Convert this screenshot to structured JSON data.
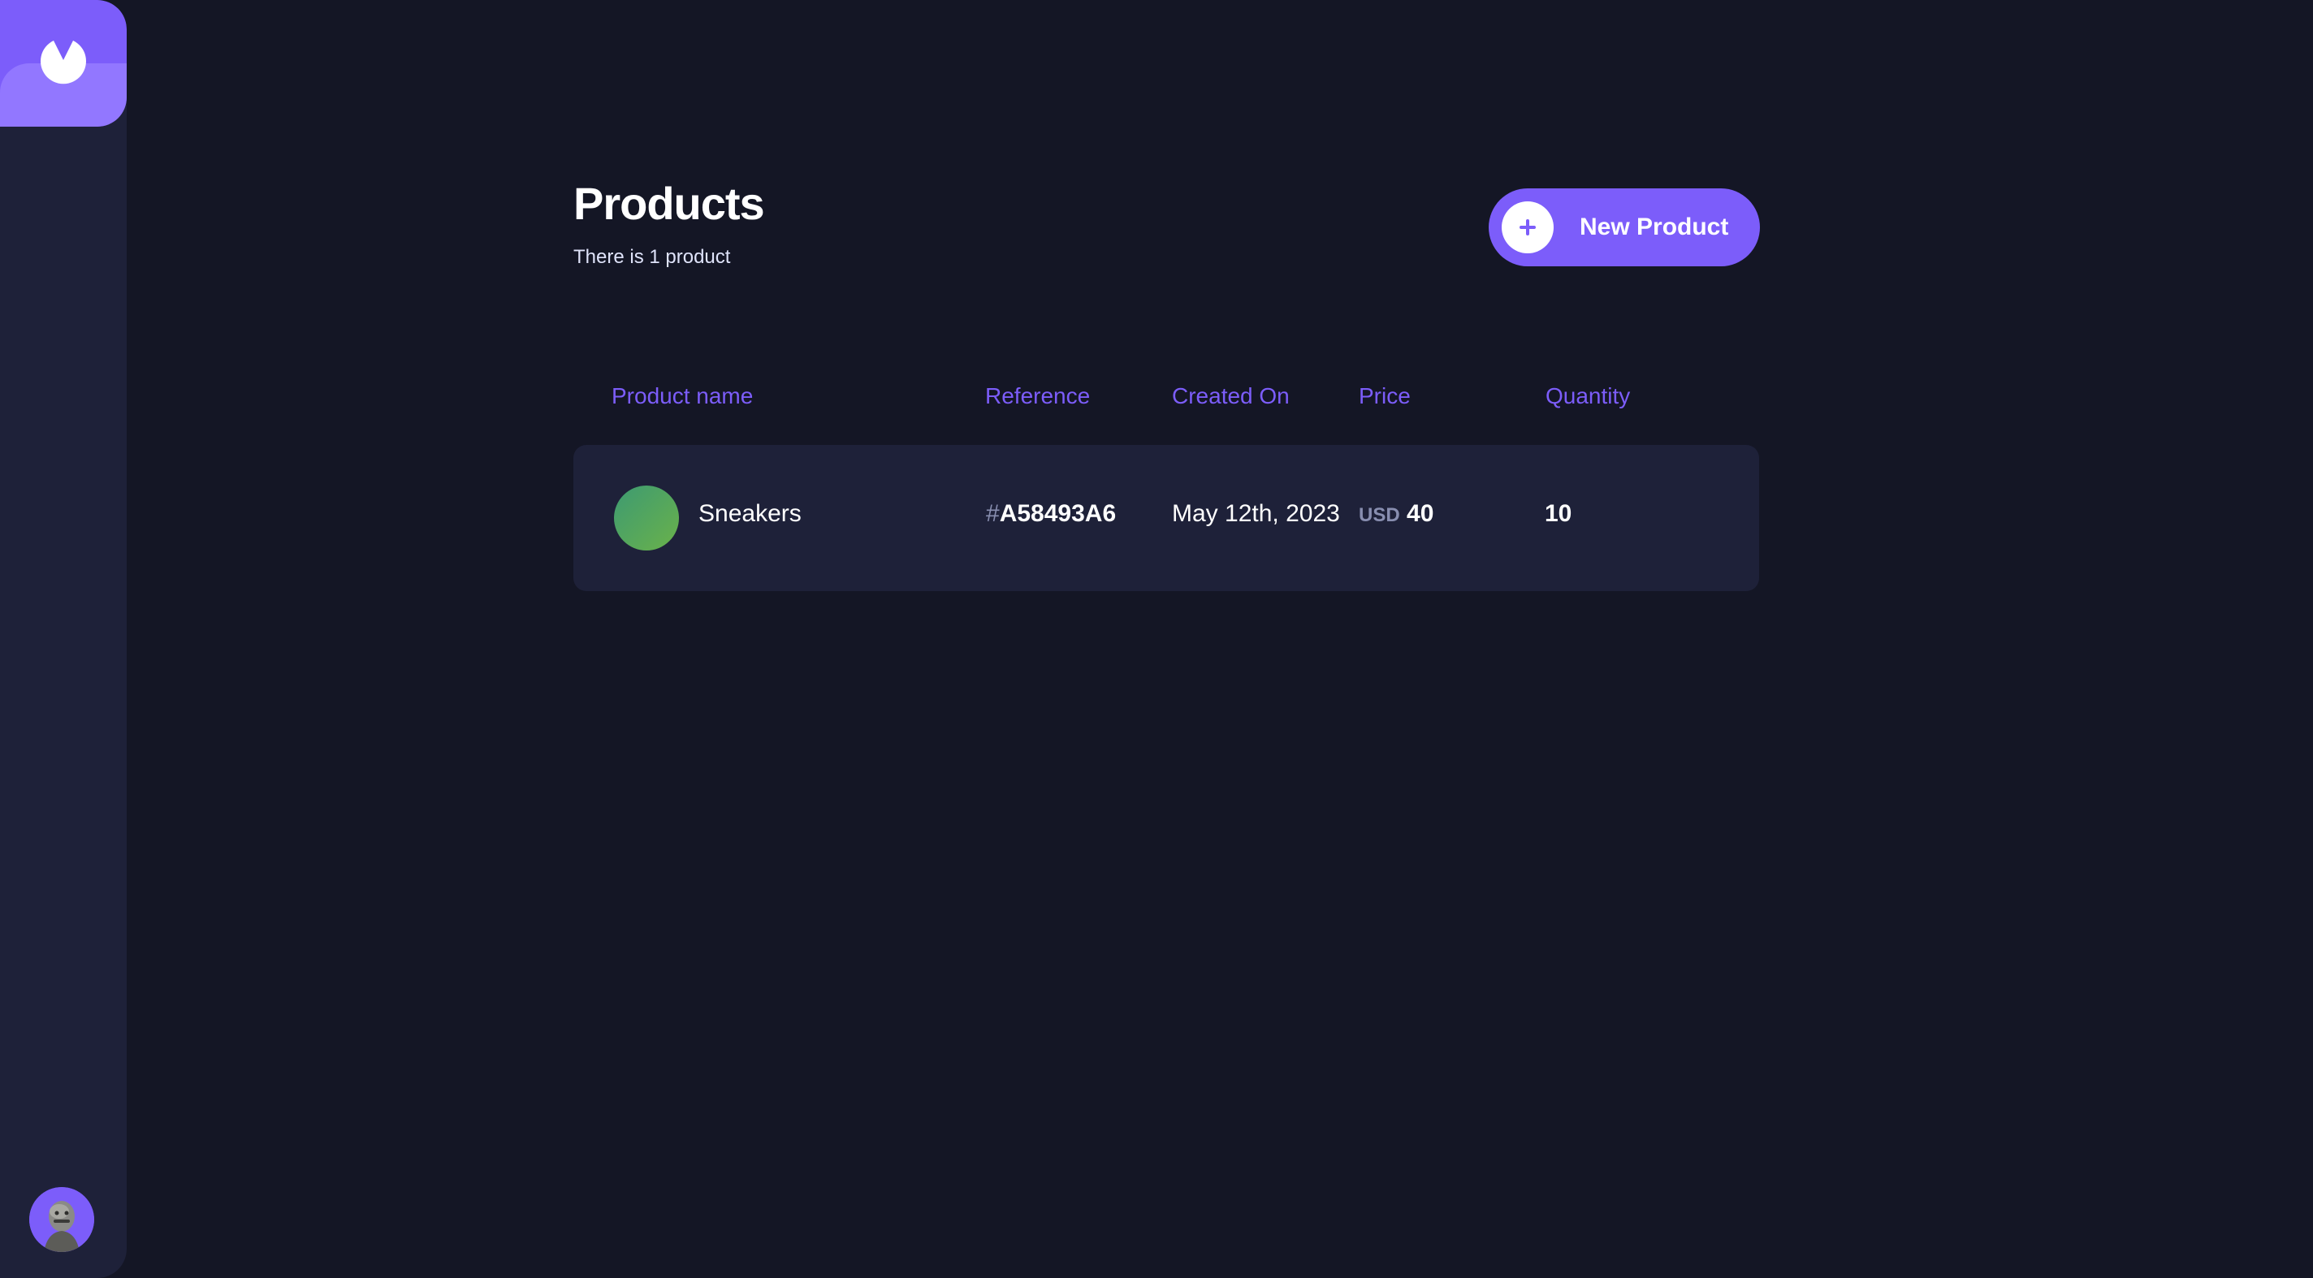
{
  "page": {
    "title": "Products",
    "subtitle": "There is 1 product"
  },
  "actions": {
    "new_product_label": "New Product"
  },
  "table": {
    "columns": [
      "Product name",
      "Reference",
      "Created On",
      "Price",
      "Quantity"
    ],
    "rows": [
      {
        "name": "Sneakers",
        "reference_prefix": "#",
        "reference": "A58493A6",
        "created_on": "May 12th, 2023",
        "currency": "USD",
        "price": "40",
        "quantity": "10"
      }
    ]
  },
  "colors": {
    "background": "#141625",
    "sidebar": "#1e2139",
    "accent": "#7c5dfa",
    "accent_light": "#9277ff",
    "muted": "#888eb0"
  },
  "icons": {
    "logo": "logo-icon",
    "plus": "plus-icon",
    "avatar": "user-avatar"
  }
}
